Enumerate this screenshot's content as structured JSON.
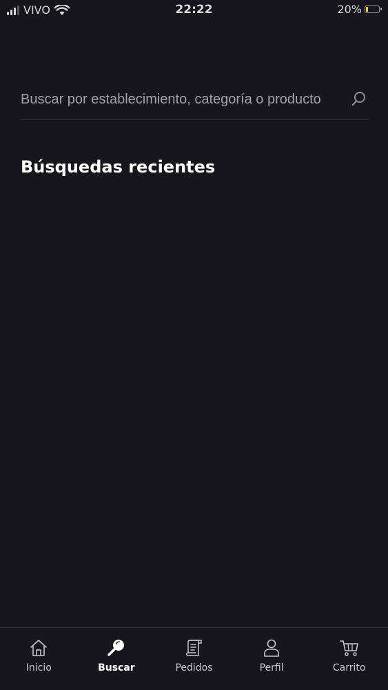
{
  "status_bar": {
    "carrier": "VIVO",
    "time": "22:22",
    "battery_text": "20%",
    "battery_level": 0.2,
    "battery_color": "#f3d44a"
  },
  "search": {
    "placeholder": "Buscar por establecimiento, categoría o producto",
    "value": "",
    "icon": "search-icon"
  },
  "recent_searches": {
    "title": "Búsquedas recientes",
    "items": []
  },
  "tab_bar": {
    "active": "buscar",
    "tabs": [
      {
        "id": "inicio",
        "label": "Inicio",
        "icon": "home-icon"
      },
      {
        "id": "buscar",
        "label": "Buscar",
        "icon": "search-icon"
      },
      {
        "id": "pedidos",
        "label": "Pedidos",
        "icon": "orders-icon"
      },
      {
        "id": "perfil",
        "label": "Perfil",
        "icon": "profile-icon"
      },
      {
        "id": "carrito",
        "label": "Carrito",
        "icon": "cart-icon"
      }
    ]
  },
  "colors": {
    "background": "#17161c",
    "text_primary": "#ffffff",
    "text_secondary": "#a3a2a8",
    "divider": "#2c2b31"
  }
}
